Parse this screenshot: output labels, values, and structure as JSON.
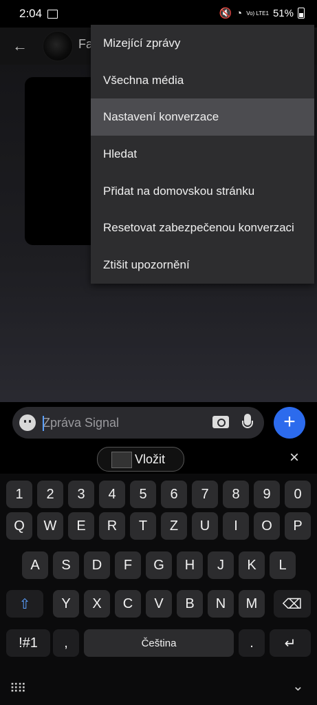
{
  "status_bar": {
    "time": "2:04",
    "signal_text": "Vo) LTE1",
    "battery": "51%"
  },
  "header": {
    "contact_name": "Fa"
  },
  "menu": {
    "items": [
      {
        "label": "Mizející zprávy"
      },
      {
        "label": "Všechna média"
      },
      {
        "label": "Nastavení konverzace"
      },
      {
        "label": "Hledat"
      },
      {
        "label": "Přidat na domovskou stránku"
      },
      {
        "label": "Resetovat zabezpečenou konverzaci"
      },
      {
        "label": "Ztišit upozornění"
      }
    ],
    "highlighted_index": 2
  },
  "composer": {
    "placeholder": "Zpráva Signal",
    "plus": "+"
  },
  "suggestion": {
    "paste_label": "Vložit",
    "close": "×"
  },
  "keyboard": {
    "row_numbers": [
      "1",
      "2",
      "3",
      "4",
      "5",
      "6",
      "7",
      "8",
      "9",
      "0"
    ],
    "row_qwertz": [
      "Q",
      "W",
      "E",
      "R",
      "T",
      "Z",
      "U",
      "I",
      "O",
      "P"
    ],
    "row_asdf": [
      "A",
      "S",
      "D",
      "F",
      "G",
      "H",
      "J",
      "K",
      "L"
    ],
    "row_yxcv": [
      "Y",
      "X",
      "C",
      "V",
      "B",
      "N",
      "M"
    ],
    "symbols_key": "!#1",
    "comma_key": ",",
    "space_label": "Čeština",
    "period_key": ".",
    "shift_icon": "⇧",
    "backspace_icon": "⌫",
    "enter_icon": "↵",
    "keyboard_toggle": "⠿⠿",
    "hide_icon": "⌄"
  },
  "icons": {
    "back": "arrow-left-icon",
    "emoji": "emoji-icon",
    "camera": "camera-icon",
    "mic": "mic-icon"
  }
}
